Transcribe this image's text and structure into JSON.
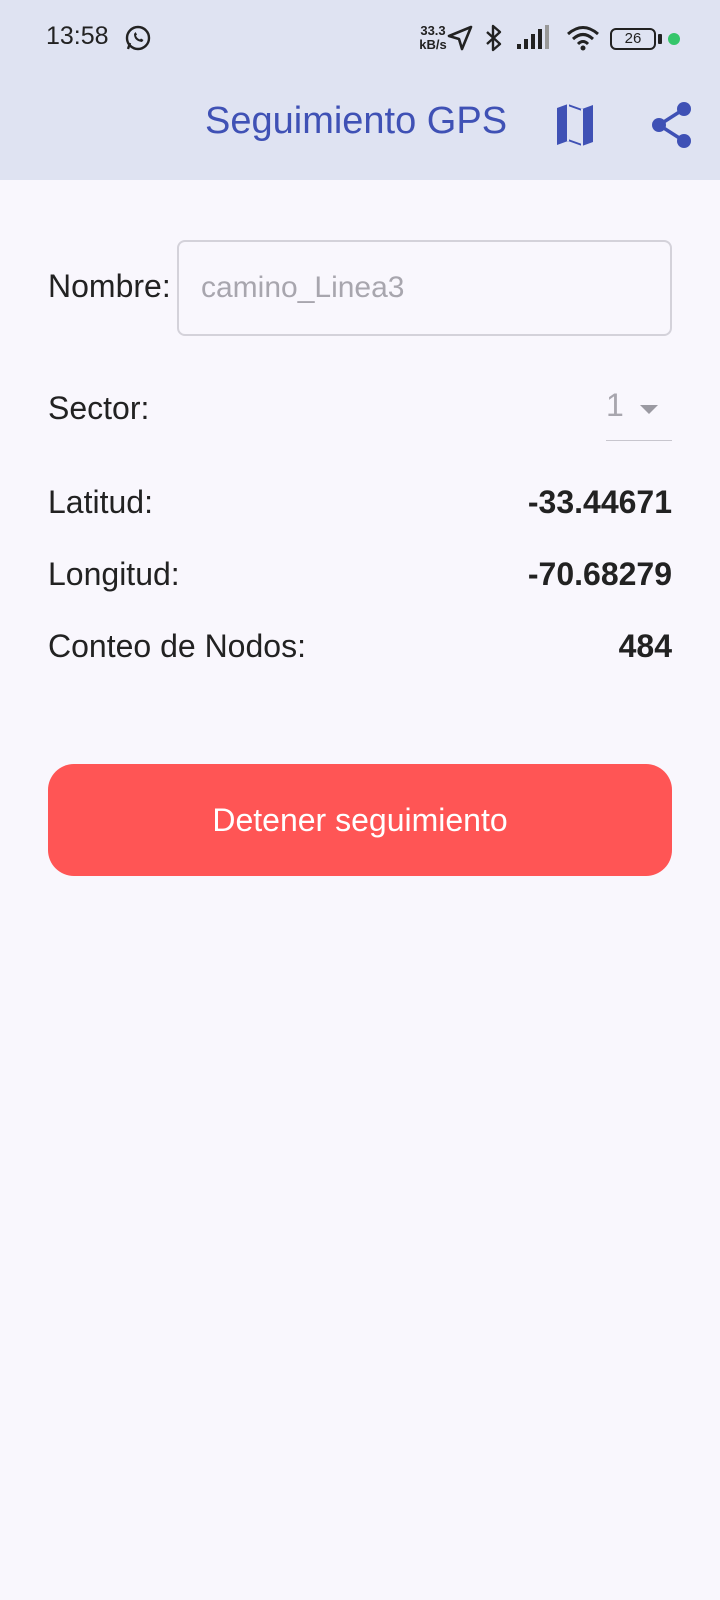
{
  "status_bar": {
    "time": "13:58",
    "speed_value": "33.3",
    "speed_unit": "kB/s",
    "battery": "26",
    "icons": [
      "whatsapp-icon",
      "location-arrow-icon",
      "bluetooth-icon",
      "signal-icon",
      "wifi-icon",
      "battery-icon",
      "green-dot"
    ]
  },
  "app_bar": {
    "title": "Seguimiento GPS",
    "actions": [
      "map-icon",
      "share-icon"
    ],
    "accent_color": "#3f51b5",
    "background_color": "#dfe3f2"
  },
  "form": {
    "name_label": "Nombre:",
    "name_placeholder": "camino_Linea3",
    "name_value": "",
    "sector_label": "Sector:",
    "sector_value": "1"
  },
  "readings": {
    "latitude_label": "Latitud:",
    "latitude_value": "-33.44671",
    "longitude_label": "Longitud:",
    "longitude_value": "-70.68279",
    "node_count_label": "Conteo de Nodos:",
    "node_count_value": "484"
  },
  "actions": {
    "stop_label": "Detener seguimiento",
    "stop_color": "#ff5555"
  }
}
